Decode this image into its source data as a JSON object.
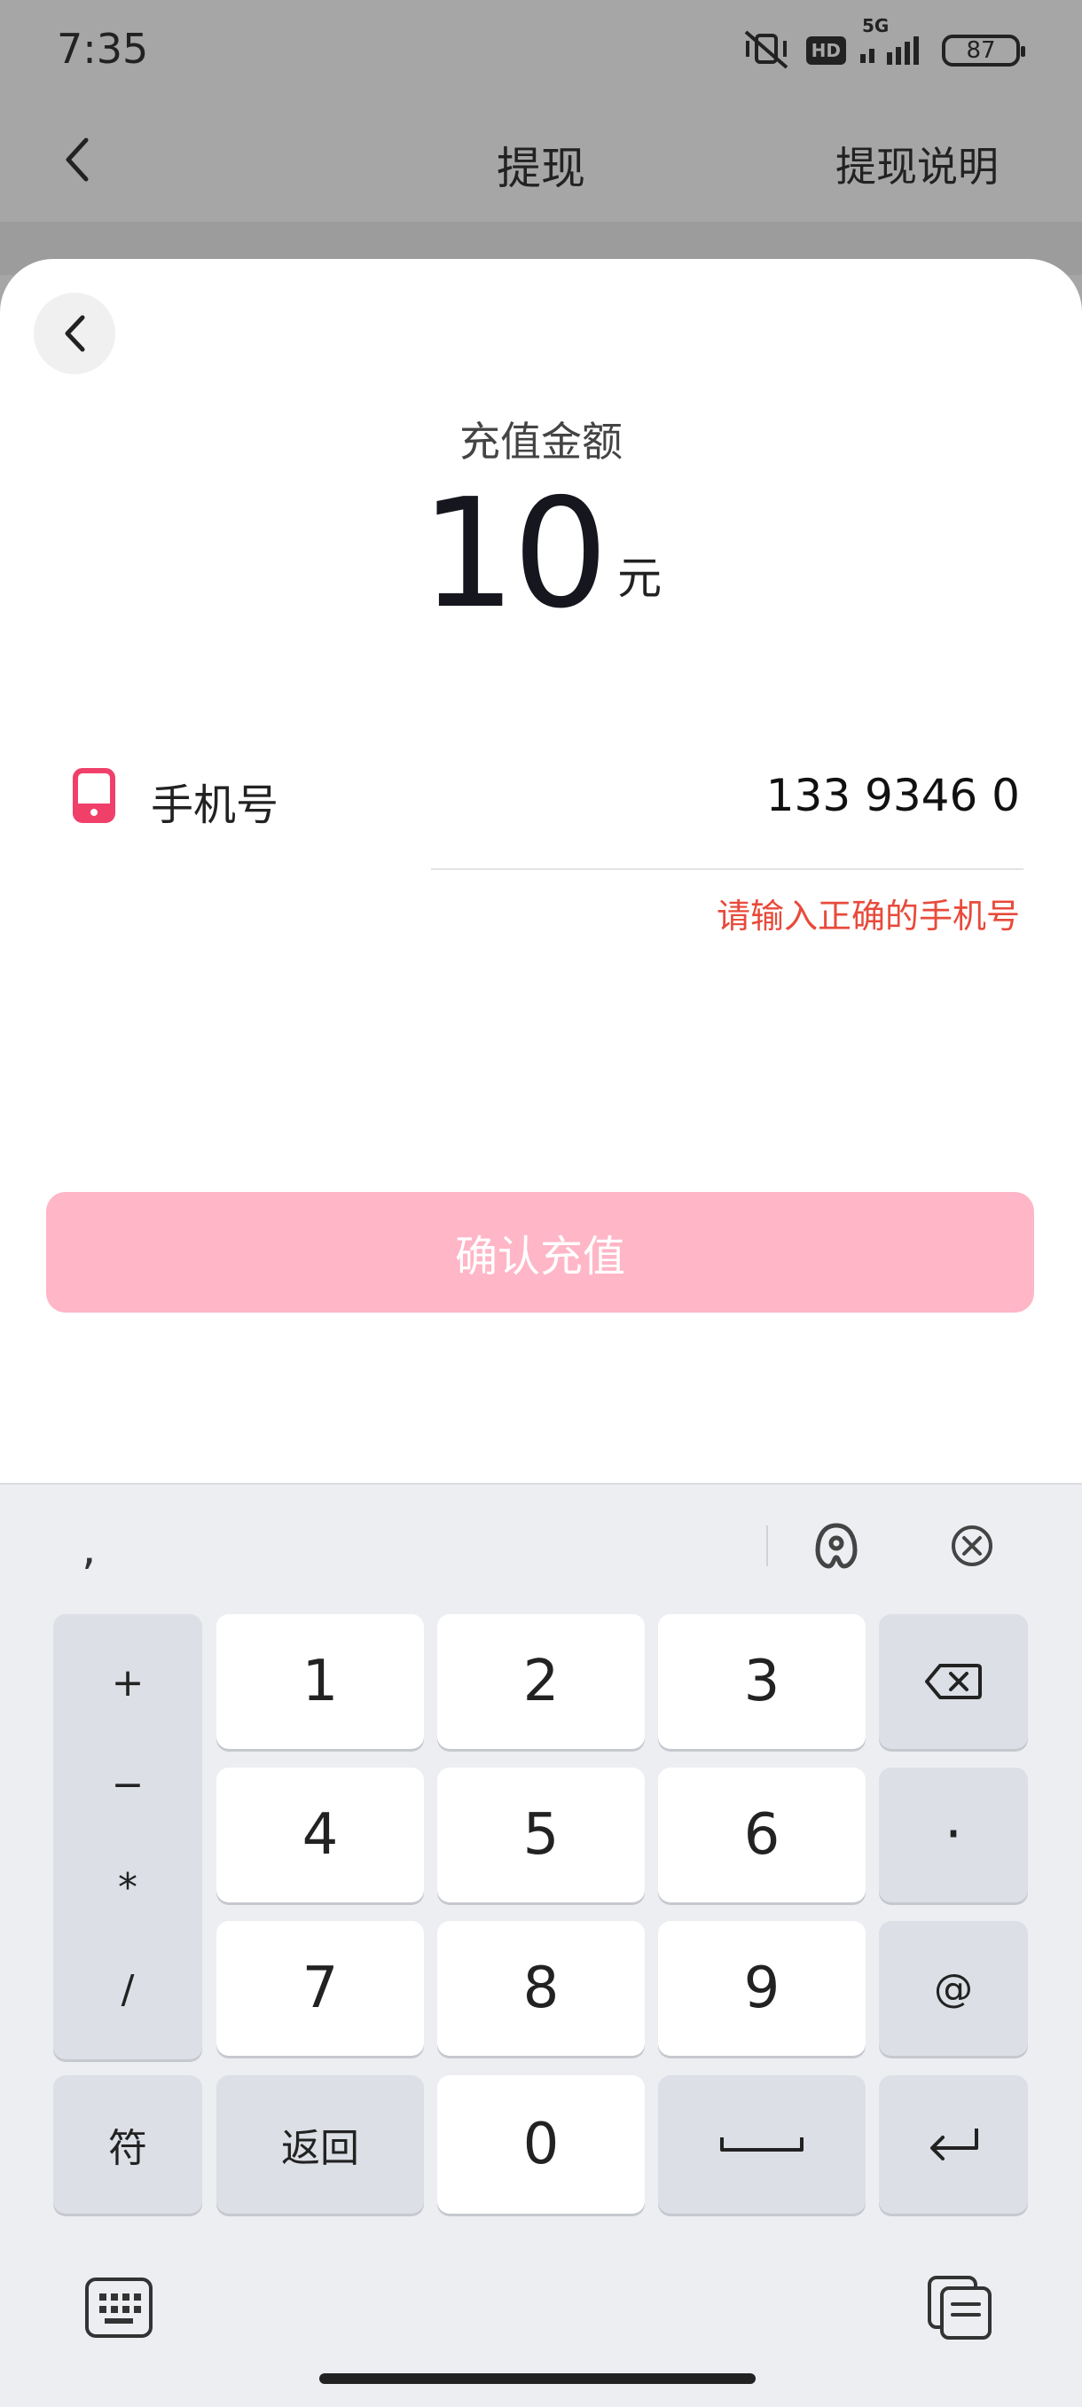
{
  "status": {
    "time": "7:35",
    "hd": "HD",
    "network": "5G",
    "battery": "87"
  },
  "header": {
    "title": "提现",
    "right_link": "提现说明"
  },
  "sheet": {
    "amount_label": "充值金额",
    "amount": "10",
    "unit": "元",
    "phone_label": "手机号",
    "phone_value": "133 9346 0",
    "error": "请输入正确的手机号",
    "confirm": "确认充值"
  },
  "keyboard": {
    "comma": ",",
    "symbols": [
      "+",
      "−",
      "*",
      "/"
    ],
    "digits": [
      "1",
      "2",
      "3",
      "4",
      "5",
      "6",
      "7",
      "8",
      "9",
      "0"
    ],
    "dot": "·",
    "at": "@",
    "fu": "符",
    "back": "返回"
  },
  "colors": {
    "accent_pink": "#ffb6c6",
    "error_red": "#e84a3b",
    "phone_icon": "#f0406a"
  }
}
